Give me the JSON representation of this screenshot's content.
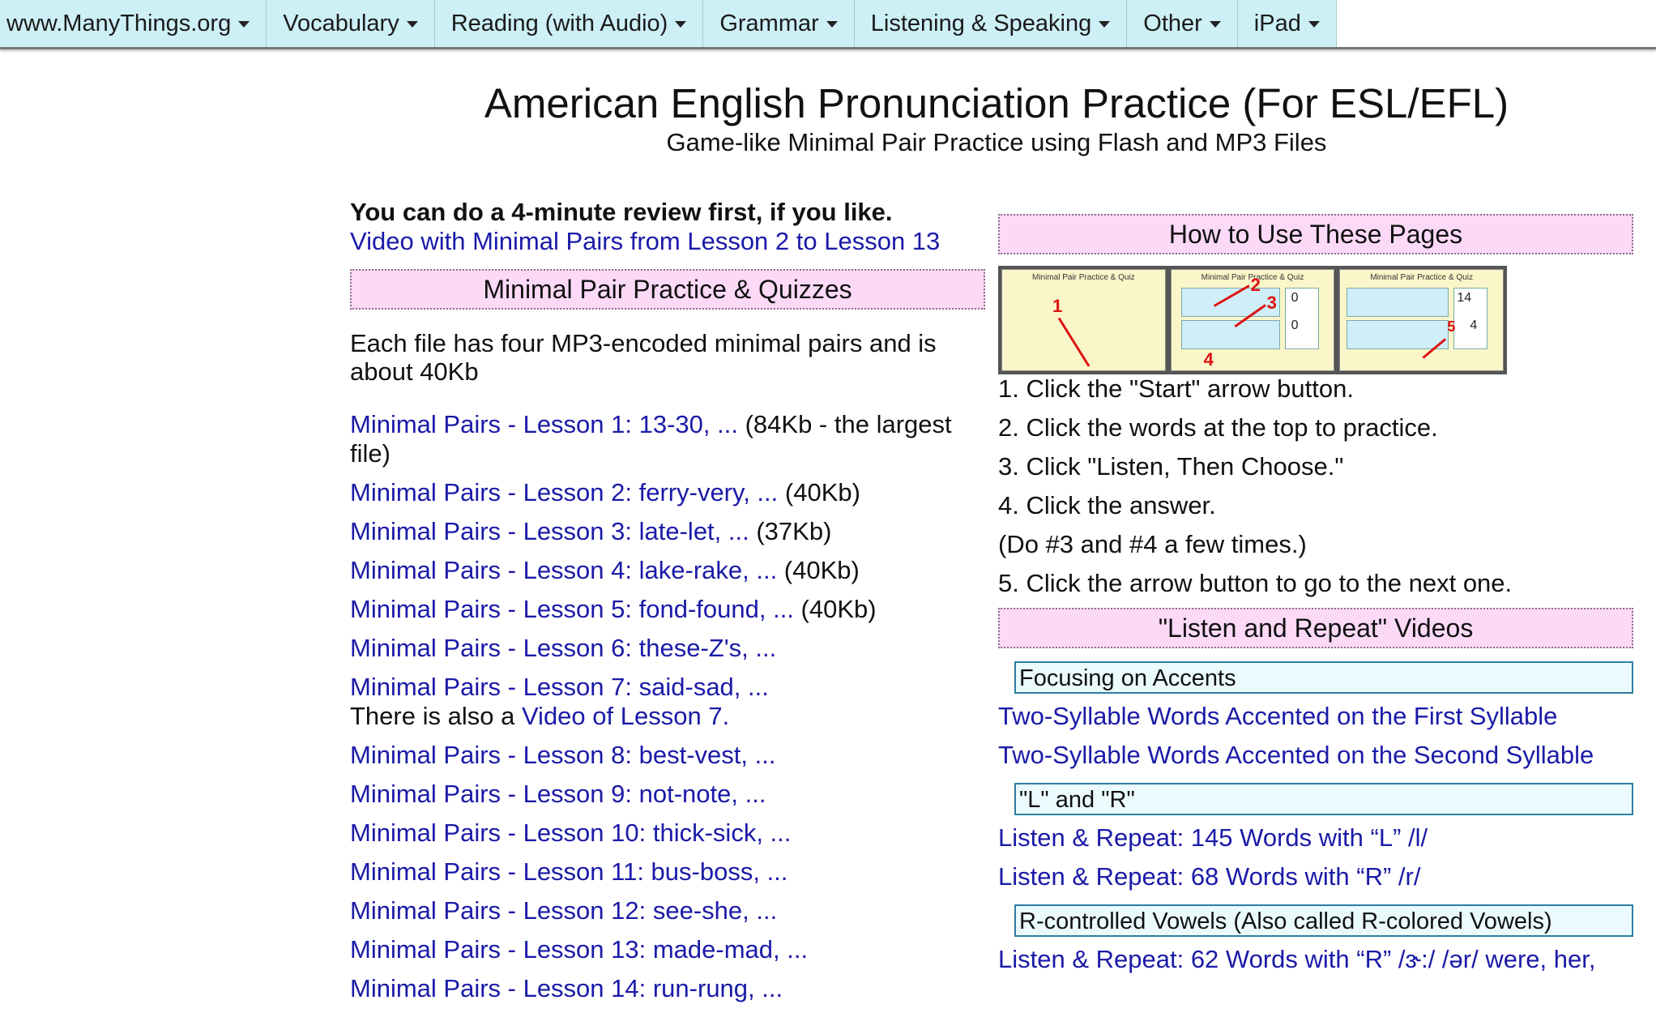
{
  "nav": {
    "items": [
      {
        "label": "www.ManyThings.org"
      },
      {
        "label": "Vocabulary"
      },
      {
        "label": "Reading (with Audio)"
      },
      {
        "label": "Grammar"
      },
      {
        "label": "Listening & Speaking"
      },
      {
        "label": "Other"
      },
      {
        "label": "iPad"
      }
    ]
  },
  "header": {
    "title": "American English Pronunciation Practice (For ESL/EFL)",
    "subtitle": "Game-like Minimal Pair Practice using Flash and MP3 Files"
  },
  "left": {
    "review_heading": "You can do a 4-minute review first, if you like.",
    "review_link": "Video with Minimal Pairs from Lesson 2 to Lesson 13",
    "section_title": "Minimal Pair Practice & Quizzes",
    "intro": "Each file has four MP3-encoded minimal pairs and is about 40Kb",
    "lessons": [
      {
        "link": "Minimal Pairs - Lesson 1: 13-30, ...",
        "size": " (84Kb - the largest file)"
      },
      {
        "link": "Minimal Pairs - Lesson 2: ferry-very, ...",
        "size": " (40Kb)"
      },
      {
        "link": "Minimal Pairs - Lesson 3: late-let, ...",
        "size": " (37Kb)"
      },
      {
        "link": "Minimal Pairs - Lesson 4: lake-rake, ...",
        "size": " (40Kb)"
      },
      {
        "link": "Minimal Pairs - Lesson 5: fond-found, ...",
        "size": " (40Kb)"
      },
      {
        "link": "Minimal Pairs - Lesson 6: these-Z's, ...",
        "size": ""
      },
      {
        "link": "Minimal Pairs - Lesson 7: said-sad, ...",
        "size": "",
        "extra_prefix": "There is also a ",
        "extra_link": "Video of Lesson 7",
        "extra_suffix": "."
      },
      {
        "link": "Minimal Pairs - Lesson 8: best-vest, ...",
        "size": ""
      },
      {
        "link": "Minimal Pairs - Lesson 9: not-note, ...",
        "size": ""
      },
      {
        "link": "Minimal Pairs - Lesson 10: thick-sick, ...",
        "size": ""
      },
      {
        "link": "Minimal Pairs - Lesson 11: bus-boss, ...",
        "size": ""
      },
      {
        "link": "Minimal Pairs - Lesson 12: see-she, ...",
        "size": ""
      },
      {
        "link": "Minimal Pairs - Lesson 13: made-mad, ...",
        "size": ""
      },
      {
        "link": "Minimal Pairs - Lesson 14: run-rung, ...",
        "size": ""
      }
    ]
  },
  "right": {
    "howto_title": "How to Use These Pages",
    "thumbnails": {
      "title": "Minimal Pair Practice & Quiz",
      "numbers": [
        "1",
        "2",
        "3",
        "4",
        "5"
      ],
      "score_values": [
        "0",
        "0",
        "14",
        "4"
      ]
    },
    "steps": [
      "1. Click the \"Start\" arrow button.",
      "2. Click the words at the top to practice.",
      "3. Click \"Listen, Then Choose.\"",
      "4. Click the answer.",
      "(Do #3 and #4 a few times.)",
      "5. Click the arrow button to go to the next one."
    ],
    "videos_title": "\"Listen and Repeat\" Videos",
    "categories": [
      {
        "title": "Focusing on Accents",
        "links": [
          "Two-Syllable Words Accented on the First Syllable",
          "Two-Syllable Words Accented on the Second Syllable"
        ]
      },
      {
        "title": "\"L\" and \"R\"",
        "links": [
          "Listen & Repeat: 145 Words with “L” /l/",
          "Listen & Repeat: 68 Words with “R” /r/"
        ]
      },
      {
        "title": "R-controlled Vowels (Also called R-colored Vowels)",
        "links": [
          "Listen & Repeat: 62 Words with “R” /ɝ:/ /ər/ were, her,"
        ]
      }
    ]
  }
}
